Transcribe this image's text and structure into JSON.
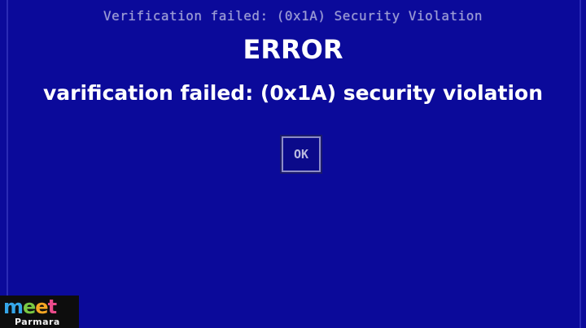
{
  "screen": {
    "bios_title": "Verification failed: (0x1A) Security Violation",
    "heading": "ERROR",
    "message": "varification failed: (0x1A) security violation",
    "ok_label": "OK"
  },
  "watermark": {
    "logo_letters": [
      "m",
      "e",
      "e",
      "t"
    ],
    "logo_sub": "Parmara",
    "logo_letter_colors": [
      "#35a6e8",
      "#7ac943",
      "#f5a623",
      "#e94b8a"
    ]
  },
  "colors": {
    "background": "#0b0a9a",
    "text_primary": "#ffffff",
    "bios_text": "#9d9dd4"
  }
}
